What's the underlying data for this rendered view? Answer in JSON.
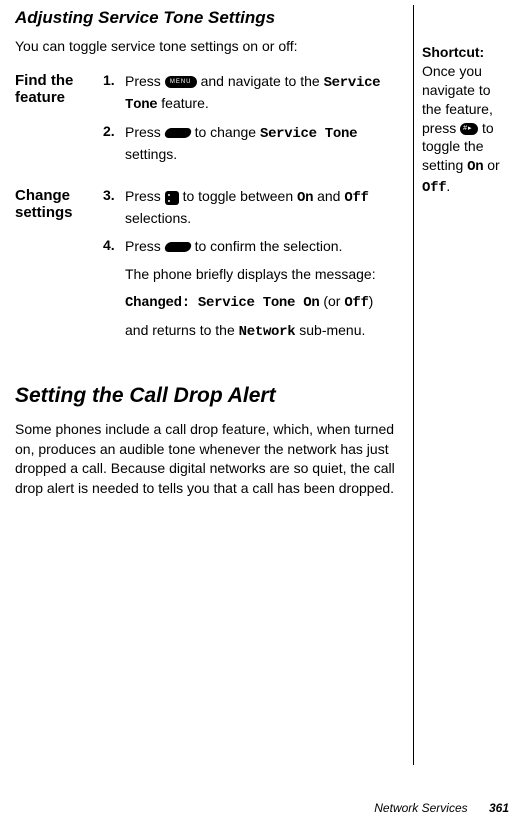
{
  "heading1": "Adjusting Service Tone Settings",
  "intro": "You can toggle service tone settings on or off:",
  "findFeature": {
    "label": "Find the feature",
    "step1": {
      "num": "1.",
      "pre": "Press ",
      "mid": " and navigate to the ",
      "mono": "Service Tone",
      "post": " feature."
    },
    "step2": {
      "num": "2.",
      "pre": "Press ",
      "mid": " to change ",
      "mono": "Service Tone",
      "post": " settings."
    }
  },
  "changeSettings": {
    "label": "Change settings",
    "step3": {
      "num": "3.",
      "pre": "Press ",
      "mid": " to toggle between ",
      "mono1": "On",
      "and": " and ",
      "mono2": "Off",
      "post": " selections."
    },
    "step4": {
      "num": "4.",
      "pre": "Press ",
      "post": " to confirm the selection."
    },
    "follow1": "The phone briefly displays the message:",
    "follow2a": "Changed: Service Tone On",
    "follow2b": " (or ",
    "follow2c": "Off",
    "follow2d": ")",
    "follow3a": "and returns to the ",
    "follow3b": "Network",
    "follow3c": " sub-menu."
  },
  "heading2": "Setting the Call Drop Alert",
  "paragraph2": "Some phones include a call drop feature, which, when turned on, produces an audible tone whenever the network has just dropped a call. Because digital networks are so quiet, the call drop alert is needed to tells you that a call has been dropped.",
  "shortcut": {
    "heading": "Shortcut:",
    "line1": "Once you navigate to the feature, press ",
    "line2": " to toggle the setting ",
    "on": "On",
    "or": " or ",
    "off": "Off",
    "period": "."
  },
  "footer": {
    "section": "Network Services",
    "page": "361"
  },
  "menuLabel": "MENU"
}
